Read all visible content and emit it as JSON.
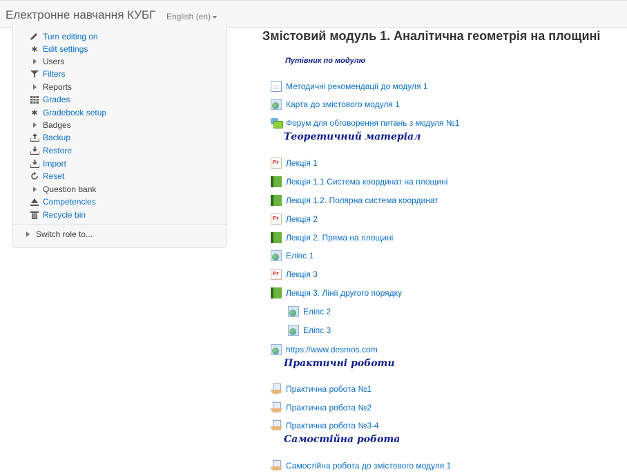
{
  "header": {
    "site_name": "Електронне навчання КУБГ",
    "language": "English (en)"
  },
  "admin": {
    "items": [
      {
        "label": "Turn editing on",
        "icon": "pencil-icon"
      },
      {
        "label": "Edit settings",
        "icon": "gear-icon"
      },
      {
        "label": "Users",
        "icon": "expand-arrow-icon"
      },
      {
        "label": "Filters",
        "icon": "filter-icon"
      },
      {
        "label": "Reports",
        "icon": "expand-arrow-icon"
      },
      {
        "label": "Grades",
        "icon": "table-icon"
      },
      {
        "label": "Gradebook setup",
        "icon": "gear-icon"
      },
      {
        "label": "Badges",
        "icon": "expand-arrow-icon"
      },
      {
        "label": "Backup",
        "icon": "upload-icon"
      },
      {
        "label": "Restore",
        "icon": "download-icon"
      },
      {
        "label": "Import",
        "icon": "download-icon"
      },
      {
        "label": "Reset",
        "icon": "refresh-icon"
      },
      {
        "label": "Question bank",
        "icon": "expand-arrow-icon"
      },
      {
        "label": "Competencies",
        "icon": "competencies-icon"
      },
      {
        "label": "Recycle bin",
        "icon": "trash-icon"
      }
    ],
    "switch_role": "Switch role to..."
  },
  "section": {
    "title": "Змістовий модуль 1. Аналітична геометрія на площині",
    "guide": "Путівник по модулю",
    "subheads": [
      "Теоретичний матеріал",
      "Практичні роботи",
      "Самостійна робота"
    ],
    "activities": [
      {
        "label": "Методичні рекомендації до модуля 1",
        "icon": "page-icon"
      },
      {
        "label": "Карта до змістового модуля 1",
        "icon": "url-icon"
      },
      {
        "label": "Форум для обговорення питань з модуля №1",
        "icon": "forum-icon"
      },
      {
        "label": "Лекція 1",
        "icon": "pdf-icon"
      },
      {
        "label": "Лекція 1.1 Система координат на площині",
        "icon": "book-icon"
      },
      {
        "label": "Лекція 1.2. Полярна система координат",
        "icon": "book-icon"
      },
      {
        "label": "Лекція 2",
        "icon": "pdf-icon"
      },
      {
        "label": "Лекція 2. Пряма на площині",
        "icon": "book-icon"
      },
      {
        "label": "Еліпс 1",
        "icon": "url-icon"
      },
      {
        "label": "Лекція 3",
        "icon": "pdf-icon"
      },
      {
        "label": "Лекція 3. Лінії другого порядку",
        "icon": "book-icon"
      },
      {
        "label": "Еліпс 2",
        "icon": "url-icon"
      },
      {
        "label": "Еліпс 3",
        "icon": "url-icon"
      },
      {
        "label": "https://www.desmos.com",
        "icon": "url-icon"
      },
      {
        "label": "Практична робота №1",
        "icon": "assignment-icon"
      },
      {
        "label": "Практична робота №2",
        "icon": "assignment-icon"
      },
      {
        "label": "Практична робота №3-4",
        "icon": "assignment-icon"
      },
      {
        "label": "Самостійна робота до змістового модуля 1",
        "icon": "assignment-icon"
      }
    ]
  }
}
